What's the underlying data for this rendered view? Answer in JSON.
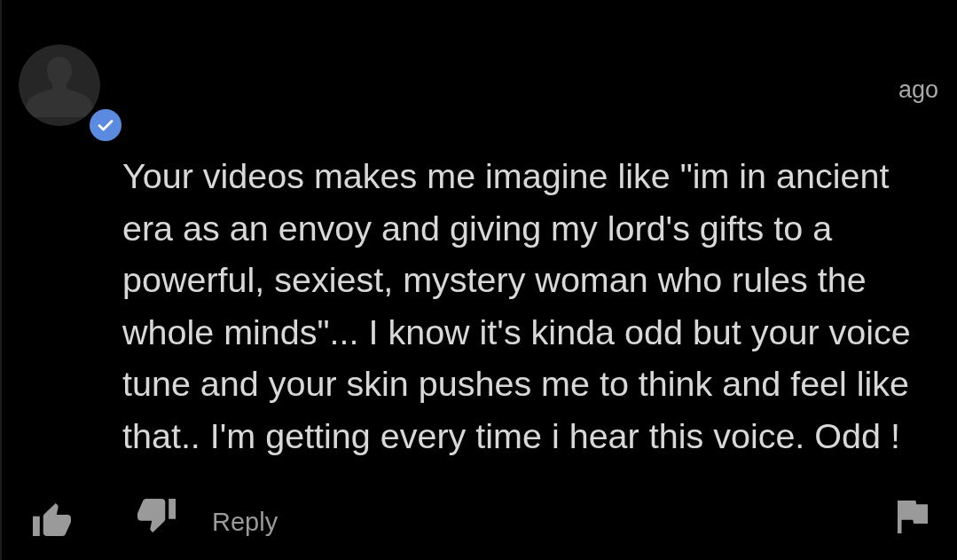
{
  "comment": {
    "author": {
      "verified": true
    },
    "time": "ago",
    "text": "Your videos makes me imagine like \"im in ancient era as an envoy and giving my lord's gifts to a powerful, sexiest, mystery woman who rules the whole minds\"... I know it's kinda odd but your voice tune and your skin pushes me to think and feel like that.. I'm getting every time i hear this voice. Odd !",
    "actions": {
      "reply": "Reply"
    }
  }
}
